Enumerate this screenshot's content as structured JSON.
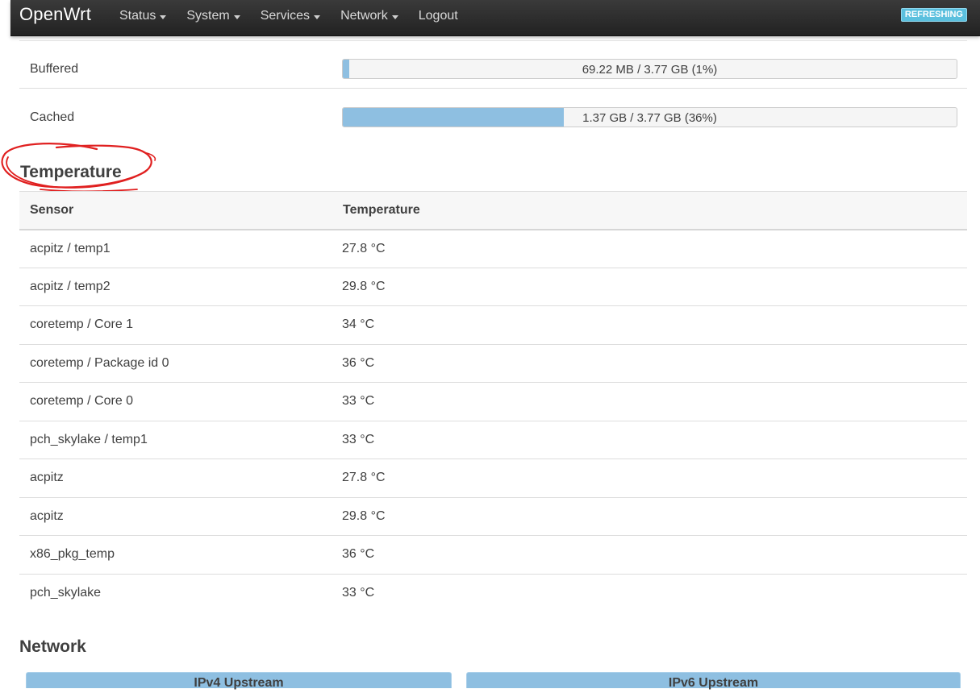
{
  "navbar": {
    "brand": "OpenWrt",
    "menu": [
      {
        "label": "Status",
        "has_dropdown": true
      },
      {
        "label": "System",
        "has_dropdown": true
      },
      {
        "label": "Services",
        "has_dropdown": true
      },
      {
        "label": "Network",
        "has_dropdown": true
      },
      {
        "label": "Logout",
        "has_dropdown": false
      }
    ],
    "status_badge": "REFRESHING"
  },
  "memory": {
    "rows": [
      {
        "label": "Buffered",
        "text": "69.22 MB / 3.77 GB (1%)",
        "percent": 1
      },
      {
        "label": "Cached",
        "text": "1.37 GB / 3.77 GB (36%)",
        "percent": 36
      }
    ]
  },
  "temperature": {
    "title": "Temperature",
    "headers": {
      "sensor": "Sensor",
      "temperature": "Temperature"
    },
    "rows": [
      {
        "sensor": "acpitz / temp1",
        "value": "27.8 °C"
      },
      {
        "sensor": "acpitz / temp2",
        "value": "29.8 °C"
      },
      {
        "sensor": "coretemp / Core 1",
        "value": "34 °C"
      },
      {
        "sensor": "coretemp / Package id 0",
        "value": "36 °C"
      },
      {
        "sensor": "coretemp / Core 0",
        "value": "33 °C"
      },
      {
        "sensor": "pch_skylake / temp1",
        "value": "33 °C"
      },
      {
        "sensor": "acpitz",
        "value": "27.8 °C"
      },
      {
        "sensor": "acpitz",
        "value": "29.8 °C"
      },
      {
        "sensor": "x86_pkg_temp",
        "value": "36 °C"
      },
      {
        "sensor": "pch_skylake",
        "value": "33 °C"
      }
    ]
  },
  "network": {
    "title": "Network",
    "panels": [
      "IPv4 Upstream",
      "IPv6 Upstream"
    ]
  },
  "colors": {
    "progress_fill": "#8ebfe1",
    "badge": "#5bc0de",
    "annotation": "#e02020"
  }
}
